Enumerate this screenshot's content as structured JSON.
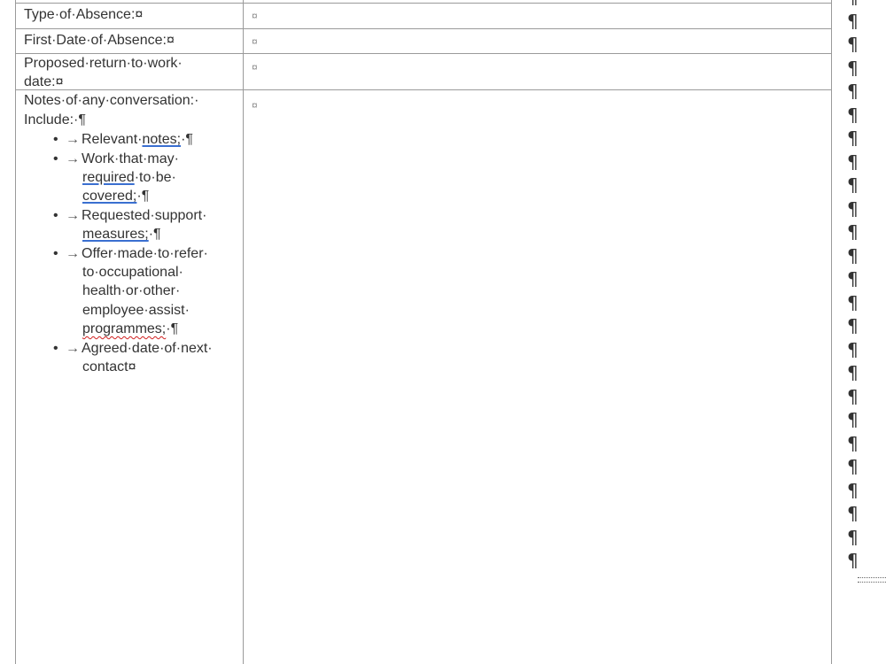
{
  "table": {
    "rows": [
      {
        "label": "Type·of·Absence:¤",
        "value_mark": "¤"
      },
      {
        "label": "First·Date·of·Absence:¤",
        "value_mark": "¤"
      },
      {
        "label_line1": "Proposed·return·to·work·",
        "label_line2": "date:¤",
        "value_mark": "¤"
      },
      {
        "label_line1": "Notes·of·any·conversation:·",
        "label_line2": "Include:·¶",
        "value_mark": "¤"
      }
    ]
  },
  "notes_list": {
    "bullet": "•",
    "arrow": "→",
    "items": [
      {
        "pre": "Relevant·",
        "ul": "notes;",
        "post": "·¶"
      },
      {
        "line1": "Work·that·may·",
        "l2_ul": "required",
        "l2_post": "·to·be·",
        "l3_ul": "covered;",
        "l3_post": "·¶"
      },
      {
        "line1": "Requested·support·",
        "l2_ul": "measures;",
        "l2_post": "·¶"
      },
      {
        "line1": "Offer·made·to·refer·",
        "line2": "to·occupational·",
        "line3": "health·or·other·",
        "line4": "employee·assist·",
        "l5_wavy": "programmes;",
        "l5_post": "·¶"
      },
      {
        "line1": "Agreed·date·of·next·",
        "line2": "contact¤"
      }
    ]
  },
  "margin_marks": {
    "pilcrow": "¶",
    "count": 25
  }
}
